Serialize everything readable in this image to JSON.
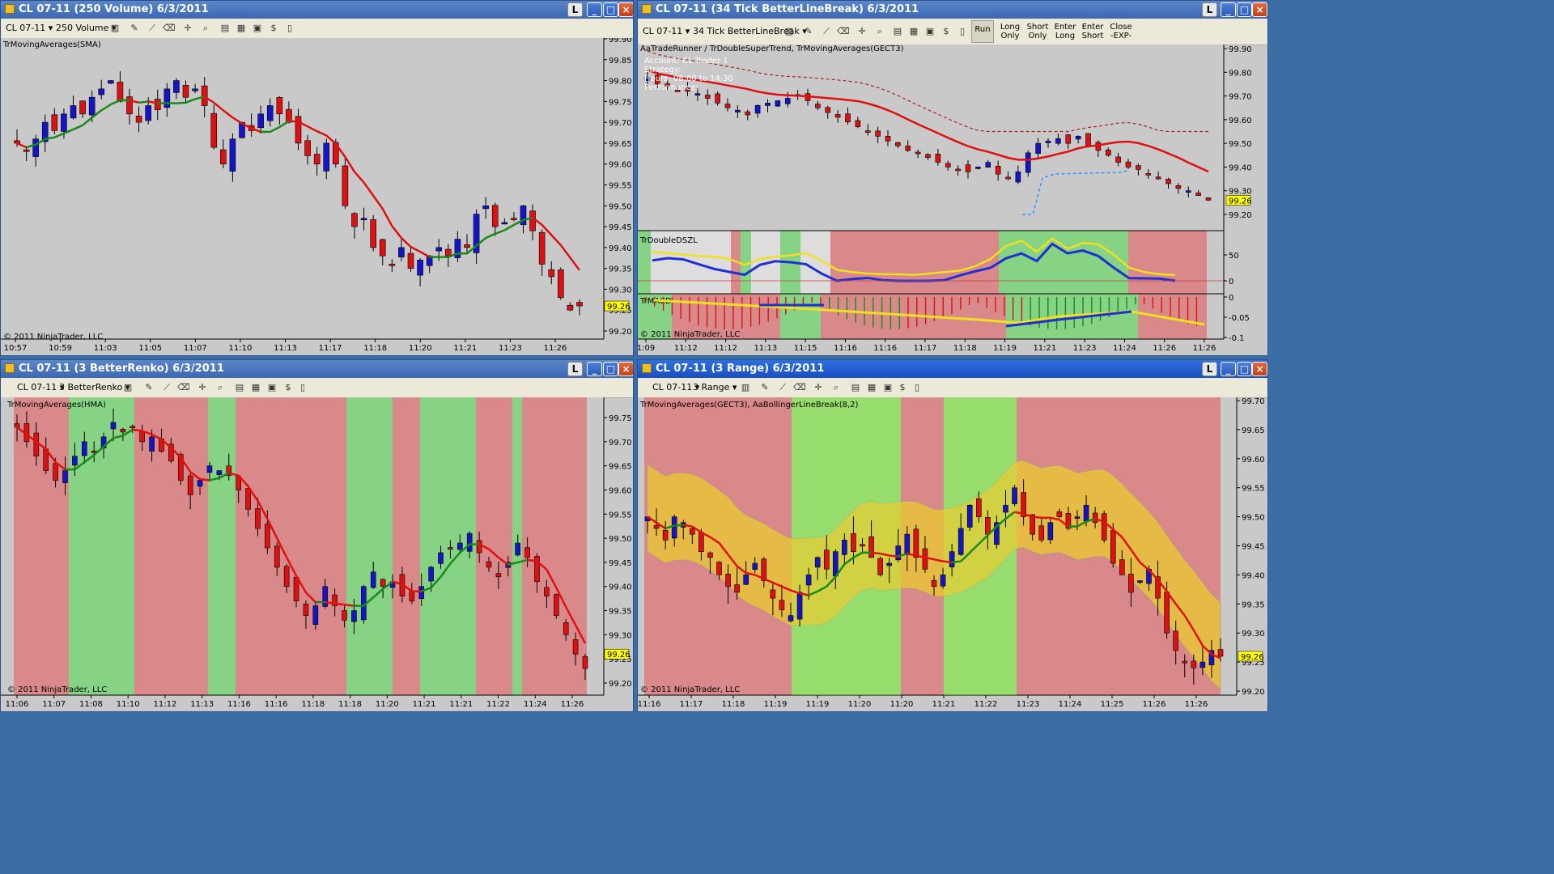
{
  "windows": [
    {
      "id": "tl",
      "title": "CL 07-11 (250 Volume)  6/3/2011",
      "instrument": "CL 07-11",
      "bar_type": "250 Volume",
      "indicator": "TrMovingAverages(SMA)",
      "copyright": "© 2011 NinjaTrader, LLC",
      "price_marker": "99.26",
      "y_ticks": [
        "99.90",
        "99.85",
        "99.80",
        "99.75",
        "99.70",
        "99.65",
        "99.60",
        "99.55",
        "99.50",
        "99.45",
        "99.40",
        "99.35",
        "99.30",
        "99.25",
        "99.20"
      ],
      "x_ticks": [
        "10:57",
        "10:59",
        "11:03",
        "11:05",
        "11:07",
        "11:10",
        "11:13",
        "11:17",
        "11:18",
        "11:20",
        "11:21",
        "11:23",
        "11:26"
      ]
    },
    {
      "id": "tr",
      "title": "CL 07-11 (34 Tick BetterLineBreak)  6/3/2011",
      "instrument": "CL 07-11",
      "bar_type": "34 Tick BetterLineBreak",
      "indicator": "AaTradeRunner / TrDoubleSuperTrend, TrMovingAverages(GECT3)",
      "overlay": [
        "Account:  CL Trader 1",
        "Strategy:",
        "Hours: 08:00 to 14:30",
        "Performance:"
      ],
      "buttons": [
        "Run",
        "Long Only",
        "Short Only",
        "Enter Long",
        "Enter Short",
        "Close -EXP-"
      ],
      "subpanel1": "TrDoubleDSZL",
      "subpanel2": "TrMACD",
      "copyright": "© 2011 NinjaTrader, LLC",
      "price_marker": "99.26",
      "y_ticks": [
        "99.90",
        "99.80",
        "99.70",
        "99.60",
        "99.50",
        "99.40",
        "99.30",
        "99.20"
      ],
      "sub1_ticks": [
        "50",
        "0"
      ],
      "sub2_ticks": [
        "0",
        "-0.05",
        "-0.1"
      ],
      "x_ticks": [
        "1:09",
        "11:12",
        "11:12",
        "11:13",
        "11:15",
        "11:16",
        "11:16",
        "11:17",
        "11:18",
        "11:19",
        "11:21",
        "11:23",
        "11:24",
        "11:26",
        "11:26"
      ]
    },
    {
      "id": "bl",
      "title": "CL 07-11 (3 BetterRenko)  6/3/2011",
      "instrument": "CL 07-11",
      "bar_type": "3 BetterRenko",
      "indicator": "TrMovingAverages(HMA)",
      "copyright": "© 2011 NinjaTrader, LLC",
      "price_marker": "99.26",
      "y_ticks": [
        "99.75",
        "99.70",
        "99.65",
        "99.60",
        "99.55",
        "99.50",
        "99.45",
        "99.40",
        "99.35",
        "99.30",
        "99.25",
        "99.20"
      ],
      "x_ticks": [
        "11:06",
        "11:07",
        "11:08",
        "11:10",
        "11:12",
        "11:13",
        "11:16",
        "11:16",
        "11:18",
        "11:18",
        "11:20",
        "11:21",
        "11:21",
        "11:22",
        "11:24",
        "11:26"
      ]
    },
    {
      "id": "br",
      "title": "CL 07-11 (3 Range)  6/3/2011",
      "instrument": "CL 07-11",
      "bar_type": "3 Range",
      "indicator": "TrMovingAverages(GECT3), AaBollingerLineBreak(8,2)",
      "copyright": "© 2011 NinjaTrader, LLC",
      "price_marker": "99.26",
      "y_ticks": [
        "99.70",
        "99.65",
        "99.60",
        "99.55",
        "99.50",
        "99.45",
        "99.40",
        "99.35",
        "99.30",
        "99.25",
        "99.20"
      ],
      "x_ticks": [
        "11:16",
        "11:17",
        "11:18",
        "11:19",
        "11:19",
        "11:20",
        "11:20",
        "11:21",
        "11:22",
        "11:23",
        "11:24",
        "11:25",
        "11:26",
        "11:26"
      ]
    }
  ],
  "colors": {
    "up": "#1414c8",
    "down": "#dd1111",
    "ma_up": "#178a17",
    "ma_down": "#e01010",
    "zone_red": "#d98989",
    "zone_green": "#86d386",
    "panel_bg": "#c9c9c9",
    "marker": "#ffff00"
  },
  "icons": [
    "instrument-dropdown-icon",
    "bartype-dropdown-icon",
    "bars-icon",
    "pencil-icon",
    "drawing-tool-icon",
    "crosshair-icon",
    "zoom-icon",
    "properties-icon",
    "data-box-icon",
    "strategy-icon",
    "chart-trader-icon"
  ]
}
